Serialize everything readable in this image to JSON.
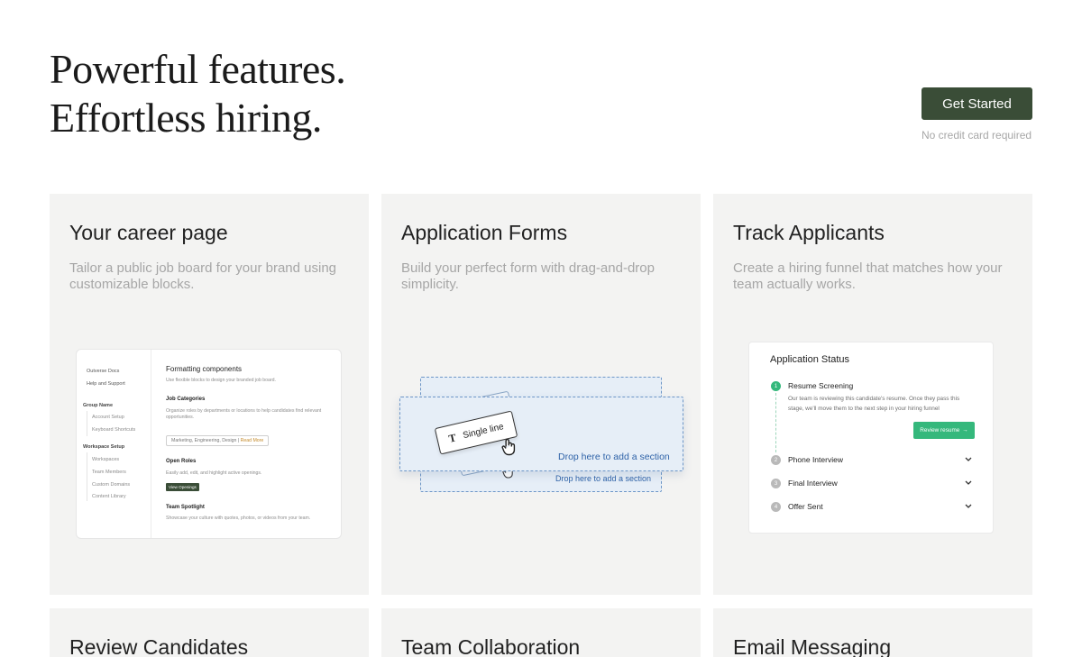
{
  "hero": {
    "title_line1": "Powerful features.",
    "title_line2": "Effortless hiring.",
    "cta_label": "Get Started",
    "cta_note": "No credit card required"
  },
  "colors": {
    "primary": "#3a4d37",
    "card_bg": "#f3f3f2",
    "accent_green": "#35b87c",
    "accent_blue": "#2f63a8"
  },
  "cards": {
    "career": {
      "title": "Your career page",
      "desc": "Tailor a public job board for your brand using customizable blocks.",
      "mock": {
        "sidebar": {
          "docs": "Outverse Docs",
          "help": "Help and Support",
          "group_name": "Group Name",
          "account_setup": "Account Setup",
          "keyboard_shortcuts": "Keyboard Shortcuts",
          "workspace_setup": "Workspace Setup",
          "workspaces": "Workspaces",
          "team_members": "Team Members",
          "custom_domains": "Custom Domains",
          "content_library": "Content Library"
        },
        "main": {
          "heading": "Formatting components",
          "heading_desc": "Use flexible blocks to design your branded job board.",
          "job_categories": "Job Categories",
          "job_categories_desc": "Organize roles by departments or locations to help candidates find relevant opportunities.",
          "tags_value": "Marketing, Engineering, Design",
          "tags_sep": " | ",
          "tags_read_more": "Read More",
          "open_roles": "Open Roles",
          "open_roles_desc": "Easily add, edit, and highlight active openings.",
          "view_openings": "View Openings",
          "team_spotlight": "Team Spotlight",
          "team_spotlight_desc": "Showcase your culture with quotes, photos, or videos from your team."
        }
      }
    },
    "forms": {
      "title": "Application Forms",
      "desc": "Build your perfect form with drag-and-drop simplicity.",
      "mock": {
        "chip_icon": "T",
        "chip_label": "Single line",
        "drop_front": "Drop here to add a section",
        "drop_back": "Drop here to add a section"
      }
    },
    "track": {
      "title": "Track Applicants",
      "desc": "Create a hiring funnel that matches how your team actually works.",
      "mock": {
        "title": "Application Status",
        "steps": [
          {
            "num": "1",
            "name": "Resume Screening",
            "desc": "Our team is reviewing this candidate's resume. Once they pass this stage, we'll move them to the next step in your hiring funnel"
          },
          {
            "num": "2",
            "name": "Phone Interview"
          },
          {
            "num": "3",
            "name": "Final Interview"
          },
          {
            "num": "4",
            "name": "Offer Sent"
          }
        ],
        "review_label": "Review resume",
        "review_arrow": "→"
      }
    },
    "review": {
      "title": "Review Candidates"
    },
    "team": {
      "title": "Team Collaboration"
    },
    "email": {
      "title": "Email Messaging"
    }
  }
}
